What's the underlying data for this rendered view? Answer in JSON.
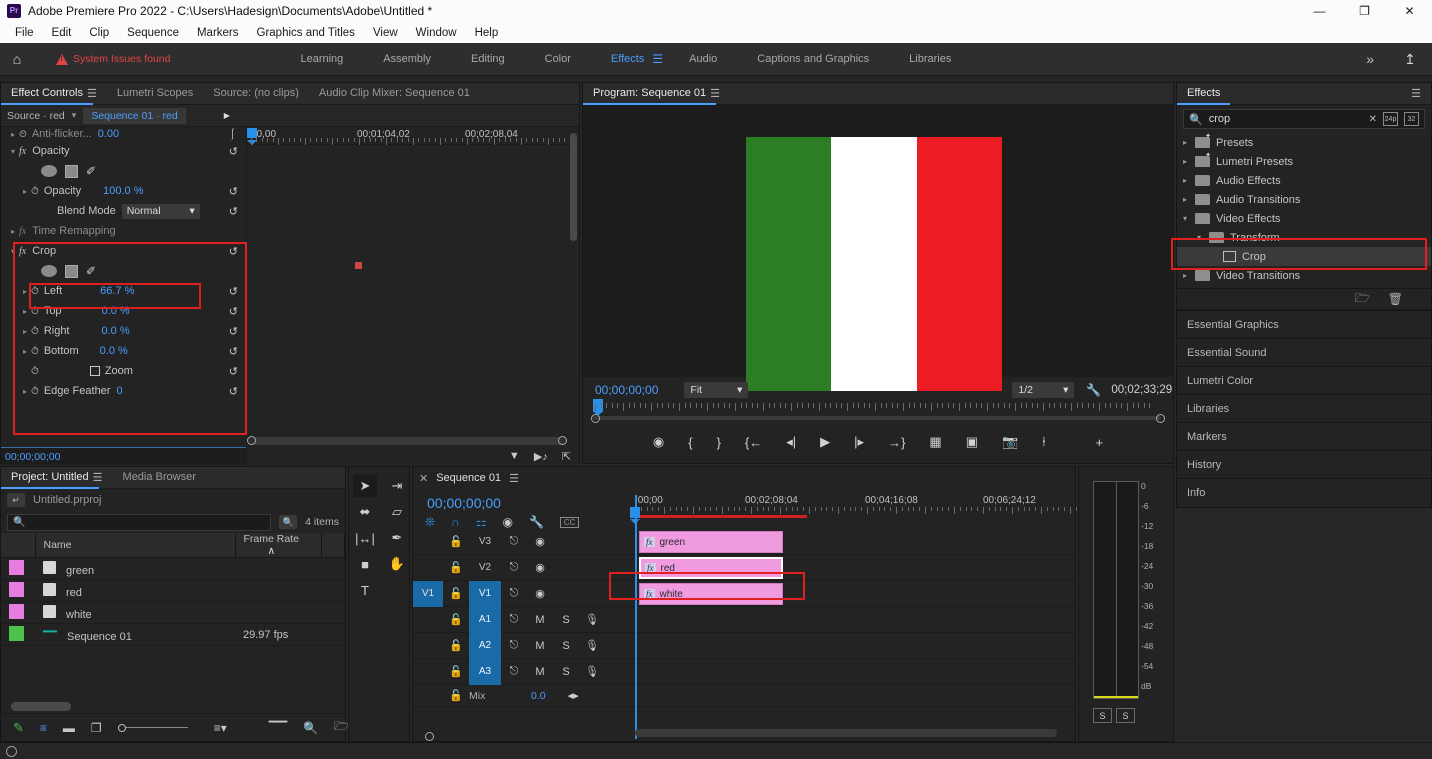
{
  "titlebar": {
    "app_title": "Adobe Premiere Pro 2022 - C:\\Users\\Hadesign\\Documents\\Adobe\\Untitled *",
    "logo": "Pr",
    "minimize": "—",
    "maximize": "❐",
    "close": "✕"
  },
  "menu": [
    "File",
    "Edit",
    "Clip",
    "Sequence",
    "Markers",
    "Graphics and Titles",
    "View",
    "Window",
    "Help"
  ],
  "workspace": {
    "home_icon": "⌂",
    "system_issues": "System Issues found",
    "tabs": [
      {
        "label": "Learning",
        "active": false
      },
      {
        "label": "Assembly",
        "active": false
      },
      {
        "label": "Editing",
        "active": false
      },
      {
        "label": "Color",
        "active": false
      },
      {
        "label": "Effects",
        "active": true
      },
      {
        "label": "Audio",
        "active": false
      },
      {
        "label": "Captions and Graphics",
        "active": false
      },
      {
        "label": "Libraries",
        "active": false
      }
    ],
    "overflow": "»",
    "share_icon": "↥"
  },
  "effect_controls": {
    "tabs": [
      {
        "label": "Effect Controls",
        "active": true
      },
      {
        "label": "Lumetri Scopes",
        "active": false
      },
      {
        "label": "Source: (no clips)",
        "active": false
      },
      {
        "label": "Audio Clip Mixer: Sequence 01",
        "active": false
      }
    ],
    "burger": "☰",
    "source_label": "Source · red",
    "sequence_label": "Sequence 01 · red",
    "ruler_labels": [
      "00,00",
      "00;01;04,02",
      "00;02;08,04"
    ],
    "timecode": "00;00;00;00",
    "params": [
      {
        "name": "Anti-flicker...",
        "value": "0.00",
        "dim": true,
        "clipped": true
      },
      {
        "name": "Opacity",
        "value": "",
        "group": true
      },
      {
        "name": "Opacity",
        "value": "100.0 %"
      },
      {
        "name": "Blend Mode",
        "value": "Normal",
        "select": true
      },
      {
        "name": "Time Remapping",
        "value": "",
        "group": true,
        "dim": true
      },
      {
        "name": "Crop",
        "value": "",
        "group": true
      },
      {
        "name": "Left",
        "value": "66.7 %",
        "highlighted": true
      },
      {
        "name": "Top",
        "value": "0.0 %"
      },
      {
        "name": "Right",
        "value": "0.0 %"
      },
      {
        "name": "Bottom",
        "value": "0.0 %"
      },
      {
        "name": "Zoom",
        "value": "",
        "checkbox": true
      },
      {
        "name": "Edge Feather",
        "value": "0"
      }
    ],
    "fx_label": "fx",
    "reset_icon": "↺",
    "bottom_icons": [
      "filter-icon",
      "audio-keyframe-icon",
      "export-icon"
    ]
  },
  "program": {
    "title": "Program: Sequence 01",
    "burger": "☰",
    "timecode_current": "00;00;00;00",
    "fit_label": "Fit",
    "resolution_label": "1/2",
    "wrench_icon": "🔧",
    "duration": "00;02;33;29",
    "flag_colors": [
      "#2d7d24",
      "#ffffff",
      "#ec1c24"
    ],
    "controls": [
      "marker",
      "mark-in",
      "mark-out",
      "go-to-in",
      "step-back",
      "play",
      "step-forward",
      "go-to-out",
      "lift",
      "extract",
      "export-frame",
      "comparison-view",
      "button-editor"
    ]
  },
  "effects_panel": {
    "title": "Effects",
    "burger": "☰",
    "search_value": "crop",
    "search_placeholder": "",
    "clear_icon": "✕",
    "badge_24p": "24p",
    "badge_32bit": "32",
    "tree": [
      {
        "label": "Presets",
        "expanded": false,
        "depth": 0,
        "star": true
      },
      {
        "label": "Lumetri Presets",
        "expanded": false,
        "depth": 0,
        "star": true
      },
      {
        "label": "Audio Effects",
        "expanded": false,
        "depth": 0
      },
      {
        "label": "Audio Transitions",
        "expanded": false,
        "depth": 0
      },
      {
        "label": "Video Effects",
        "expanded": true,
        "depth": 0
      },
      {
        "label": "Transform",
        "expanded": true,
        "depth": 1
      },
      {
        "label": "Crop",
        "leaf": true,
        "depth": 2,
        "selected": true
      },
      {
        "label": "Video Transitions",
        "expanded": false,
        "depth": 0
      }
    ],
    "new_folder_icon": "🗀",
    "delete_icon": "🗑"
  },
  "right_panels": [
    "Essential Graphics",
    "Essential Sound",
    "Lumetri Color",
    "Libraries",
    "Markers",
    "History",
    "Info"
  ],
  "project": {
    "tabs": [
      {
        "label": "Project: Untitled",
        "active": true
      },
      {
        "label": "Media Browser",
        "active": false
      }
    ],
    "burger": "☰",
    "breadcrumb": "Untitled.prproj",
    "search_placeholder": "",
    "item_count": "4 items",
    "columns": [
      "",
      "Name",
      "Frame Rate",
      ""
    ],
    "sort_icon": "∧",
    "rows": [
      {
        "color": "#e77de0",
        "name": "green",
        "frame_rate": "",
        "type": "clip"
      },
      {
        "color": "#e77de0",
        "name": "red",
        "frame_rate": "",
        "type": "clip"
      },
      {
        "color": "#e77de0",
        "name": "white",
        "frame_rate": "",
        "type": "clip"
      },
      {
        "color": "#4cc14c",
        "name": "Sequence 01",
        "frame_rate": "29.97 fps",
        "type": "sequence"
      }
    ],
    "toolbar_icons": [
      "pen-icon",
      "list-view-icon",
      "icon-view-icon",
      "freeform-view-icon",
      "zoom-slider",
      "sort-icon",
      "automate-to-sequence-icon",
      "find-icon",
      "new-bin-icon"
    ]
  },
  "tools": [
    {
      "name": "selection-tool",
      "glyph": "➤",
      "active": true
    },
    {
      "name": "track-select-forward-tool",
      "glyph": "⇥"
    },
    {
      "name": "ripple-edit-tool",
      "glyph": "⬌"
    },
    {
      "name": "razor-tool",
      "glyph": "▱"
    },
    {
      "name": "slip-tool",
      "glyph": "|↔|"
    },
    {
      "name": "pen-tool",
      "glyph": "✒"
    },
    {
      "name": "rectangle-tool",
      "glyph": "■"
    },
    {
      "name": "hand-tool",
      "glyph": "✋"
    },
    {
      "name": "type-tool",
      "glyph": "T"
    }
  ],
  "timeline": {
    "close_icon": "✕",
    "title": "Sequence 01",
    "burger": "☰",
    "timecode": "00;00;00;00",
    "tool_icons": [
      "snap-icon",
      "magnet-icon",
      "linked-selection-icon",
      "marker-icon",
      "wrench-icon",
      "captions-icon"
    ],
    "ruler_labels": [
      ";00;00",
      "00;02;08;04",
      "00;04;16;08",
      "00;06;24;12"
    ],
    "video_tracks": [
      {
        "name": "V3",
        "clip": "green",
        "targeted": false
      },
      {
        "name": "V2",
        "clip": "red",
        "targeted": false,
        "highlighted": true
      },
      {
        "name": "V1",
        "clip": "white",
        "targeted": true
      }
    ],
    "audio_tracks": [
      {
        "name": "A1",
        "m": "M",
        "s": "S"
      },
      {
        "name": "A2",
        "m": "M",
        "s": "S"
      },
      {
        "name": "A3",
        "m": "M",
        "s": "S"
      }
    ],
    "mix_label": "Mix",
    "mix_value": "0.0",
    "fx_badge": "fx",
    "lock_icon": "🔓",
    "sync_icon": "⎋",
    "eye_icon": "◉",
    "mic_icon": "🎙"
  },
  "meters": {
    "ticks": [
      "0",
      "-6",
      "-12",
      "-18",
      "-24",
      "-30",
      "-36",
      "-42",
      "-48",
      "-54",
      "dB"
    ],
    "solo_buttons": [
      "S",
      "S"
    ]
  },
  "colors": {
    "accent_blue": "#4a9eff",
    "warning_red": "#e04545",
    "highlight_red": "#e02020",
    "clip_pink": "#f09ae0",
    "track_target_blue": "#1a6aa8"
  }
}
